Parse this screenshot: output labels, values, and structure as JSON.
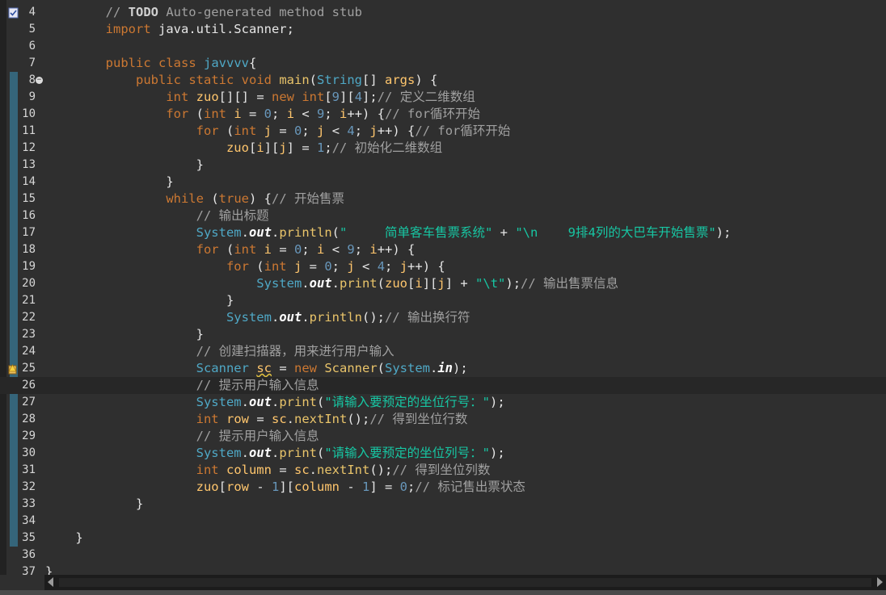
{
  "editor": {
    "current_line": 26,
    "lines": [
      {
        "n": "4",
        "indent": "        ",
        "tokens": [
          [
            "cm",
            "// "
          ],
          [
            "todo",
            "TODO"
          ],
          [
            "cm",
            " Auto-generated method stub"
          ]
        ],
        "marker": "task-icon"
      },
      {
        "n": "5",
        "indent": "        ",
        "tokens": [
          [
            "kw",
            "import"
          ],
          [
            "p",
            " java.util.Scanner;"
          ]
        ]
      },
      {
        "n": "6",
        "indent": "",
        "tokens": []
      },
      {
        "n": "7",
        "indent": "        ",
        "tokens": [
          [
            "kw",
            "public"
          ],
          [
            "p",
            " "
          ],
          [
            "kw",
            "class"
          ],
          [
            "p",
            " "
          ],
          [
            "type",
            "javvvv"
          ],
          [
            "p",
            "{"
          ]
        ]
      },
      {
        "n": "8",
        "indent": "            ",
        "tokens": [
          [
            "kw",
            "public"
          ],
          [
            "p",
            " "
          ],
          [
            "kw",
            "static"
          ],
          [
            "p",
            " "
          ],
          [
            "kw",
            "void"
          ],
          [
            "p",
            " "
          ],
          [
            "method",
            "main"
          ],
          [
            "p",
            "("
          ],
          [
            "type",
            "String"
          ],
          [
            "p",
            "[] "
          ],
          [
            "var",
            "args"
          ],
          [
            "p",
            ") {"
          ]
        ],
        "fold": true
      },
      {
        "n": "9",
        "indent": "                ",
        "tokens": [
          [
            "kw",
            "int"
          ],
          [
            "p",
            " "
          ],
          [
            "var",
            "zuo"
          ],
          [
            "p",
            "[][] = "
          ],
          [
            "kw",
            "new"
          ],
          [
            "p",
            " "
          ],
          [
            "kw",
            "int"
          ],
          [
            "p",
            "["
          ],
          [
            "num",
            "9"
          ],
          [
            "p",
            "]["
          ],
          [
            "num",
            "4"
          ],
          [
            "p",
            "];"
          ],
          [
            "cm",
            "// 定义二维数组"
          ]
        ]
      },
      {
        "n": "10",
        "indent": "                ",
        "tokens": [
          [
            "kw",
            "for"
          ],
          [
            "p",
            " ("
          ],
          [
            "kw",
            "int"
          ],
          [
            "p",
            " "
          ],
          [
            "var",
            "i"
          ],
          [
            "p",
            " = "
          ],
          [
            "num",
            "0"
          ],
          [
            "p",
            "; "
          ],
          [
            "var",
            "i"
          ],
          [
            "p",
            " < "
          ],
          [
            "num",
            "9"
          ],
          [
            "p",
            "; "
          ],
          [
            "var",
            "i"
          ],
          [
            "p",
            "++) {"
          ],
          [
            "cm",
            "// for循环开始"
          ]
        ]
      },
      {
        "n": "11",
        "indent": "                    ",
        "tokens": [
          [
            "kw",
            "for"
          ],
          [
            "p",
            " ("
          ],
          [
            "kw",
            "int"
          ],
          [
            "p",
            " "
          ],
          [
            "var",
            "j"
          ],
          [
            "p",
            " = "
          ],
          [
            "num",
            "0"
          ],
          [
            "p",
            "; "
          ],
          [
            "var",
            "j"
          ],
          [
            "p",
            " < "
          ],
          [
            "num",
            "4"
          ],
          [
            "p",
            "; "
          ],
          [
            "var",
            "j"
          ],
          [
            "p",
            "++) {"
          ],
          [
            "cm",
            "// for循环开始"
          ]
        ]
      },
      {
        "n": "12",
        "indent": "                        ",
        "tokens": [
          [
            "var",
            "zuo"
          ],
          [
            "p",
            "["
          ],
          [
            "var",
            "i"
          ],
          [
            "p",
            "]["
          ],
          [
            "var",
            "j"
          ],
          [
            "p",
            "] = "
          ],
          [
            "num",
            "1"
          ],
          [
            "p",
            ";"
          ],
          [
            "cm",
            "// 初始化二维数组"
          ]
        ]
      },
      {
        "n": "13",
        "indent": "                    ",
        "tokens": [
          [
            "p",
            "}"
          ]
        ]
      },
      {
        "n": "14",
        "indent": "                ",
        "tokens": [
          [
            "p",
            "}"
          ]
        ]
      },
      {
        "n": "15",
        "indent": "                ",
        "tokens": [
          [
            "kw",
            "while"
          ],
          [
            "p",
            " ("
          ],
          [
            "kw",
            "true"
          ],
          [
            "p",
            ") {"
          ],
          [
            "cm",
            "// 开始售票"
          ]
        ]
      },
      {
        "n": "16",
        "indent": "                    ",
        "tokens": [
          [
            "cm",
            "// 输出标题"
          ]
        ]
      },
      {
        "n": "17",
        "indent": "                    ",
        "tokens": [
          [
            "type",
            "System"
          ],
          [
            "p",
            "."
          ],
          [
            "field",
            "out"
          ],
          [
            "p",
            "."
          ],
          [
            "method",
            "println"
          ],
          [
            "p",
            "("
          ],
          [
            "str",
            "\"     简单客车售票系统\""
          ],
          [
            "p",
            " + "
          ],
          [
            "str",
            "\"\\n    9排4列的大巴车开始售票\""
          ],
          [
            "p",
            ");"
          ]
        ]
      },
      {
        "n": "18",
        "indent": "                    ",
        "tokens": [
          [
            "kw",
            "for"
          ],
          [
            "p",
            " ("
          ],
          [
            "kw",
            "int"
          ],
          [
            "p",
            " "
          ],
          [
            "var",
            "i"
          ],
          [
            "p",
            " = "
          ],
          [
            "num",
            "0"
          ],
          [
            "p",
            "; "
          ],
          [
            "var",
            "i"
          ],
          [
            "p",
            " < "
          ],
          [
            "num",
            "9"
          ],
          [
            "p",
            "; "
          ],
          [
            "var",
            "i"
          ],
          [
            "p",
            "++) {"
          ]
        ]
      },
      {
        "n": "19",
        "indent": "                        ",
        "tokens": [
          [
            "kw",
            "for"
          ],
          [
            "p",
            " ("
          ],
          [
            "kw",
            "int"
          ],
          [
            "p",
            " "
          ],
          [
            "var",
            "j"
          ],
          [
            "p",
            " = "
          ],
          [
            "num",
            "0"
          ],
          [
            "p",
            "; "
          ],
          [
            "var",
            "j"
          ],
          [
            "p",
            " < "
          ],
          [
            "num",
            "4"
          ],
          [
            "p",
            "; "
          ],
          [
            "var",
            "j"
          ],
          [
            "p",
            "++) {"
          ]
        ]
      },
      {
        "n": "20",
        "indent": "                            ",
        "tokens": [
          [
            "type",
            "System"
          ],
          [
            "p",
            "."
          ],
          [
            "field",
            "out"
          ],
          [
            "p",
            "."
          ],
          [
            "method",
            "print"
          ],
          [
            "p",
            "("
          ],
          [
            "var",
            "zuo"
          ],
          [
            "p",
            "["
          ],
          [
            "var",
            "i"
          ],
          [
            "p",
            "]["
          ],
          [
            "var",
            "j"
          ],
          [
            "p",
            "] + "
          ],
          [
            "str",
            "\"\\t\""
          ],
          [
            "p",
            ");"
          ],
          [
            "cm",
            "// 输出售票信息"
          ]
        ]
      },
      {
        "n": "21",
        "indent": "                        ",
        "tokens": [
          [
            "p",
            "}"
          ]
        ]
      },
      {
        "n": "22",
        "indent": "                        ",
        "tokens": [
          [
            "type",
            "System"
          ],
          [
            "p",
            "."
          ],
          [
            "field",
            "out"
          ],
          [
            "p",
            "."
          ],
          [
            "method",
            "println"
          ],
          [
            "p",
            "();"
          ],
          [
            "cm",
            "// 输出换行符"
          ]
        ]
      },
      {
        "n": "23",
        "indent": "                    ",
        "tokens": [
          [
            "p",
            "}"
          ]
        ]
      },
      {
        "n": "24",
        "indent": "                    ",
        "tokens": [
          [
            "cm",
            "// 创建扫描器，用来进行用户输入"
          ]
        ]
      },
      {
        "n": "25",
        "indent": "                    ",
        "tokens": [
          [
            "type",
            "Scanner"
          ],
          [
            "p",
            " "
          ],
          [
            "var",
            "sc",
            "warn"
          ],
          [
            "p",
            " = "
          ],
          [
            "kw",
            "new"
          ],
          [
            "p",
            " "
          ],
          [
            "method",
            "Scanner"
          ],
          [
            "p",
            "("
          ],
          [
            "type",
            "System"
          ],
          [
            "p",
            "."
          ],
          [
            "field",
            "in"
          ],
          [
            "p",
            ");"
          ]
        ],
        "marker": "warning-icon"
      },
      {
        "n": "26",
        "indent": "                    ",
        "tokens": [
          [
            "cm",
            "// 提示用户输入信息"
          ]
        ]
      },
      {
        "n": "27",
        "indent": "                    ",
        "tokens": [
          [
            "type",
            "System"
          ],
          [
            "p",
            "."
          ],
          [
            "field",
            "out"
          ],
          [
            "p",
            "."
          ],
          [
            "method",
            "print"
          ],
          [
            "p",
            "("
          ],
          [
            "str",
            "\"请输入要预定的坐位行号：\""
          ],
          [
            "p",
            ");"
          ]
        ]
      },
      {
        "n": "28",
        "indent": "                    ",
        "tokens": [
          [
            "kw",
            "int"
          ],
          [
            "p",
            " "
          ],
          [
            "var",
            "row"
          ],
          [
            "p",
            " = "
          ],
          [
            "var",
            "sc"
          ],
          [
            "p",
            "."
          ],
          [
            "method",
            "nextInt"
          ],
          [
            "p",
            "();"
          ],
          [
            "cm",
            "// 得到坐位行数"
          ]
        ]
      },
      {
        "n": "29",
        "indent": "                    ",
        "tokens": [
          [
            "cm",
            "// 提示用户输入信息"
          ]
        ]
      },
      {
        "n": "30",
        "indent": "                    ",
        "tokens": [
          [
            "type",
            "System"
          ],
          [
            "p",
            "."
          ],
          [
            "field",
            "out"
          ],
          [
            "p",
            "."
          ],
          [
            "method",
            "print"
          ],
          [
            "p",
            "("
          ],
          [
            "str",
            "\"请输入要预定的坐位列号：\""
          ],
          [
            "p",
            ");"
          ]
        ]
      },
      {
        "n": "31",
        "indent": "                    ",
        "tokens": [
          [
            "kw",
            "int"
          ],
          [
            "p",
            " "
          ],
          [
            "var",
            "column"
          ],
          [
            "p",
            " = "
          ],
          [
            "var",
            "sc"
          ],
          [
            "p",
            "."
          ],
          [
            "method",
            "nextInt"
          ],
          [
            "p",
            "();"
          ],
          [
            "cm",
            "// 得到坐位列数"
          ]
        ]
      },
      {
        "n": "32",
        "indent": "                    ",
        "tokens": [
          [
            "var",
            "zuo"
          ],
          [
            "p",
            "["
          ],
          [
            "var",
            "row"
          ],
          [
            "p",
            " - "
          ],
          [
            "num",
            "1"
          ],
          [
            "p",
            "]["
          ],
          [
            "var",
            "column"
          ],
          [
            "p",
            " - "
          ],
          [
            "num",
            "1"
          ],
          [
            "p",
            "] = "
          ],
          [
            "num",
            "0"
          ],
          [
            "p",
            ";"
          ],
          [
            "cm",
            "// 标记售出票状态"
          ]
        ]
      },
      {
        "n": "33",
        "indent": "            ",
        "tokens": [
          [
            "p",
            "}"
          ]
        ]
      },
      {
        "n": "34",
        "indent": "",
        "tokens": []
      },
      {
        "n": "35",
        "indent": "    ",
        "tokens": [
          [
            "p",
            "}"
          ]
        ]
      },
      {
        "n": "36",
        "indent": "",
        "tokens": []
      },
      {
        "n": "37",
        "indent": "",
        "tokens": [
          [
            "p",
            "}"
          ]
        ]
      }
    ]
  },
  "colors": {
    "background": "#2f2f2f",
    "keyword": "#cc7832",
    "type": "#4fa8c6",
    "string": "#17c6a3",
    "comment": "#a0a0a0",
    "number": "#6897bb"
  }
}
